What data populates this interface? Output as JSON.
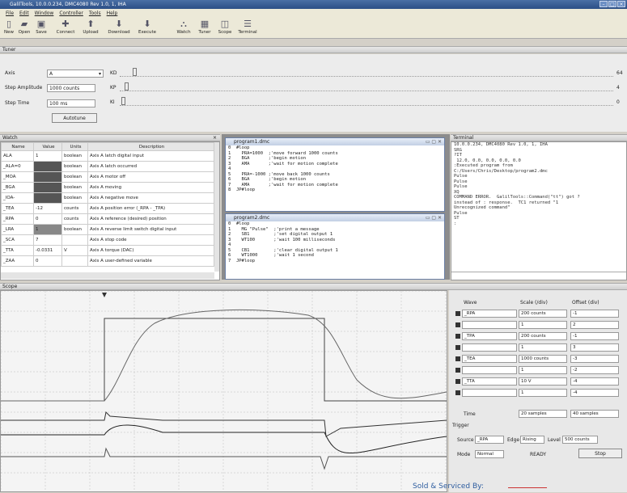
{
  "window": {
    "title": "GalilTools, 10.0.0.234, DMC4080 Rev 1.0, 1, IHA"
  },
  "menu": [
    "File",
    "Edit",
    "Window",
    "Controller",
    "Tools",
    "Help"
  ],
  "toolbar": [
    "New",
    "Open",
    "Save",
    "Connect",
    "Upload",
    "Download",
    "Execute",
    "Watch",
    "Tuner",
    "Scope",
    "Terminal"
  ],
  "tuner": {
    "title": "Tuner",
    "axis_label": "Axis",
    "axis_value": "A",
    "step_amp_label": "Step Amplitude",
    "step_amp_value": "1000 counts",
    "step_time_label": "Step Time",
    "step_time_value": "100 ms",
    "autotune": "Autotune",
    "kd": "KD",
    "kp": "KP",
    "ki": "KI",
    "kd_val": "64",
    "kp_val": "4",
    "ki_val": "0"
  },
  "watch": {
    "title": "Watch",
    "headers": [
      "Name",
      "Value",
      "Units",
      "Description"
    ],
    "rows": [
      [
        "ALA",
        "1",
        "boolean",
        "Axis A latch digital input"
      ],
      [
        "_ALA=0",
        "",
        "boolean",
        "Axis A latch occurred"
      ],
      [
        "_MOA",
        "",
        "boolean",
        "Axis A motor off"
      ],
      [
        "_BGA",
        "",
        "boolean",
        "Axis A moving"
      ],
      [
        "_IOA-",
        "",
        "boolean",
        "Axis A negative move"
      ],
      [
        "_TEA",
        "-12",
        "counts",
        "Axis A position error (_RPA - _TPA)"
      ],
      [
        "_RPA",
        "0",
        "counts",
        "Axis A reference (desired) position"
      ],
      [
        "_LRA",
        "1",
        "boolean",
        "Axis A reverse limit switch digital input"
      ],
      [
        "_SCA",
        "7",
        "",
        "Axis A stop code"
      ],
      [
        "_TTA",
        "-0.0331",
        "V",
        "Axis A torque (DAC)"
      ],
      [
        "_ZAA",
        "0",
        "",
        "Axis A user-defined variable"
      ]
    ]
  },
  "programs": [
    {
      "title": "program1.dmc",
      "lines": [
        "#loop",
        "  PRA=1000  ;'move forward 1000 counts",
        "  BGA       ;'begin motion",
        "  AMA       ;'wait for motion complete",
        "",
        "  PRA=-1000 ;'move back 1000 counts",
        "  BGA       ;'begin motion",
        "  AMA       ;'wait for motion complete",
        "JP#loop"
      ]
    },
    {
      "title": "program2.dmc",
      "lines": [
        "#loop",
        "  MG \"Pulse\"  ;'print a message",
        "  SB1         ;'set digital output 1",
        "  WT100       ;'wait 100 milliseconds",
        "",
        "  CB1         ;'clear digital output 1",
        "  WT1000      ;'wait 1 second",
        "JP#loop"
      ]
    }
  ],
  "terminal": {
    "title": "Terminal",
    "lines": [
      "10.0.0.234, DMC4080 Rev 1.0, 1, IHA",
      "SRG",
      "?IT",
      " 12.0, 0.0, 0.0, 0.0, 0.0",
      ":Executed program from",
      "C:/Users/Chris/Desktop/program2.dmc",
      "Pulse",
      "Pulse",
      "Pulse",
      "XQ",
      "COMMAND ERROR.  GalilTools::Command(\"tt\") got ?",
      "instead of : response.  TC1 returned \"1",
      "Unrecognized command\"",
      "Pulse",
      "ST",
      ":"
    ]
  },
  "scope": {
    "title": "Scope",
    "headers": [
      "Wave",
      "Scale (/div)",
      "Offset (div)"
    ],
    "rows": [
      [
        "_RPA",
        "200 counts",
        "-1"
      ],
      [
        "",
        "1",
        "2"
      ],
      [
        "_TPA",
        "200 counts",
        "-1"
      ],
      [
        "",
        "1",
        "3"
      ],
      [
        "_TEA",
        "1000 counts",
        "-3"
      ],
      [
        "",
        "1",
        "-2"
      ],
      [
        "_TTA",
        "10 V",
        "-4"
      ],
      [
        "",
        "1",
        "-4"
      ]
    ],
    "time_label": "Time",
    "time_value": "20 samples",
    "time_offset": "40 samples",
    "trigger": "Trigger",
    "source_label": "Source",
    "source_val": "_RPA",
    "edge_label": "Edge",
    "edge_val": "Rising",
    "level_label": "Level",
    "level_val": "500 counts",
    "mode_label": "Mode",
    "mode_val": "Normal",
    "status": "READY",
    "stop": "Stop"
  },
  "footer": "Sold & Serviced By:"
}
